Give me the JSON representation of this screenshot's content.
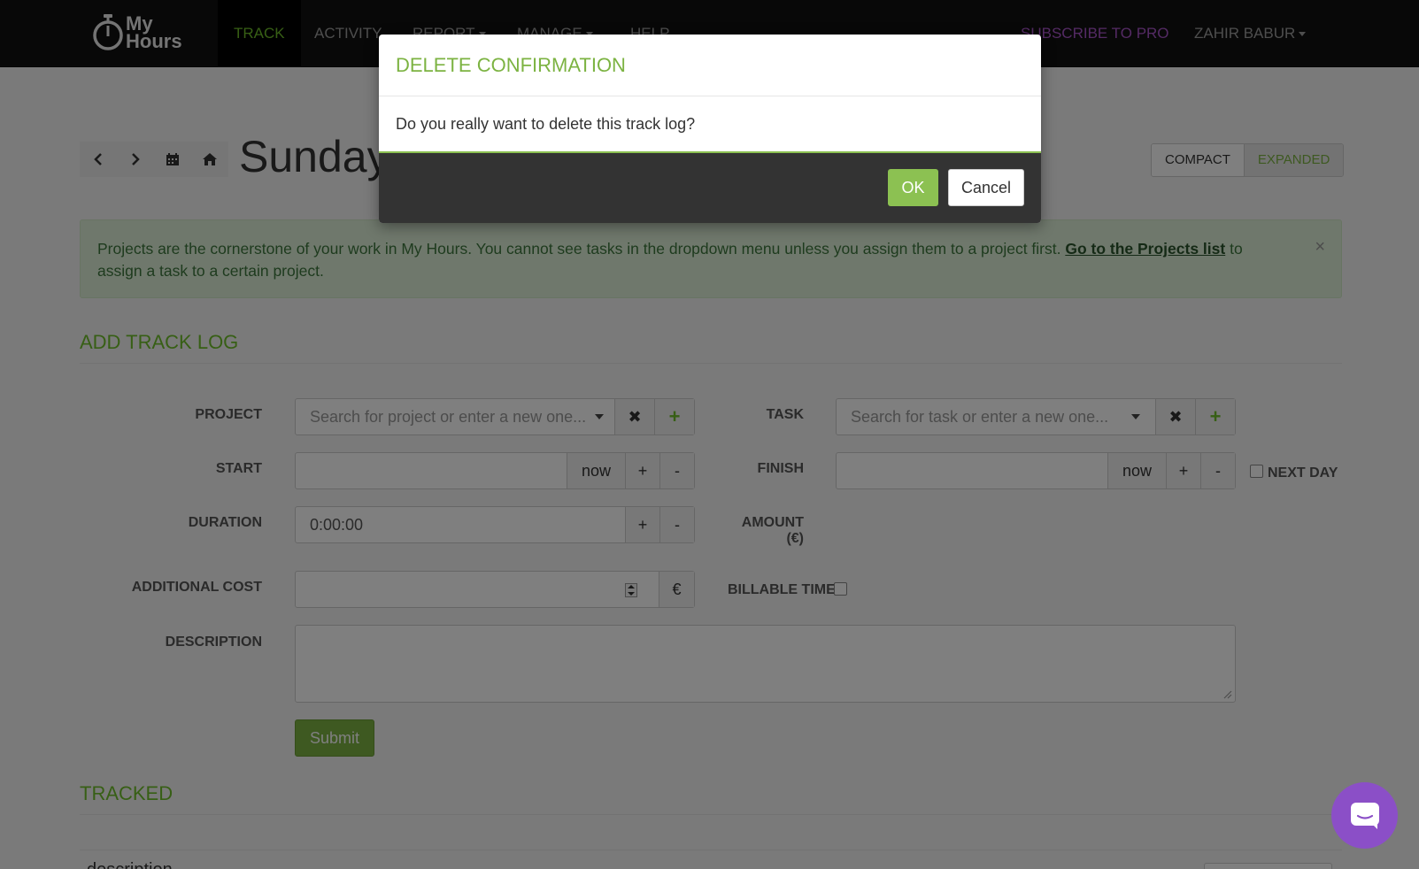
{
  "app": {
    "logo_line1": "My",
    "logo_line2": "Hours"
  },
  "nav": {
    "items": [
      {
        "label": "TRACK",
        "active": true
      },
      {
        "label": "ACTIVITY"
      },
      {
        "label": "REPORT",
        "dropdown": true
      },
      {
        "label": "MANAGE",
        "dropdown": true
      },
      {
        "label": "HELP"
      }
    ],
    "subscribe": "SUBSCRIBE TO PRO",
    "user": "ZAHIR BABUR"
  },
  "date_header": {
    "title": "Sunday",
    "view_modes": [
      "COMPACT",
      "EXPANDED"
    ],
    "active_view": "EXPANDED"
  },
  "alert": {
    "text_before": "Projects are the cornerstone of your work in My Hours. You cannot see tasks in the dropdown menu unless you assign them to a project first. ",
    "link": "Go to the Projects list",
    "text_after": " to assign a task to a certain project.",
    "close": "×"
  },
  "add_track_log": {
    "title": "ADD TRACK LOG",
    "project_label": "PROJECT",
    "project_placeholder": "Search for project or enter a new one...",
    "task_label": "TASK",
    "task_placeholder": "Search for task or enter a new one...",
    "start_label": "START",
    "finish_label": "FINISH",
    "now": "now",
    "plus": "+",
    "minus": "-",
    "next_day_label": "NEXT DAY",
    "duration_label": "DURATION",
    "duration_value": "0:00:00",
    "amount_label_1": "AMOUNT",
    "amount_label_2": "(€)",
    "additional_cost_label": "ADDITIONAL COST",
    "currency": "€",
    "billable_label": "BILLABLE TIME",
    "description_label": "DESCRIPTION",
    "submit": "Submit"
  },
  "tracked": {
    "title": "TRACKED",
    "first_row_text": "description"
  },
  "modal": {
    "title": "DELETE CONFIRMATION",
    "message": "Do you really want to delete this track log?",
    "ok": "OK",
    "cancel": "Cancel"
  },
  "colors": {
    "brand_green": "#7cb342",
    "pro_purple": "#a855c8",
    "chat_purple": "#8b4fc7"
  }
}
